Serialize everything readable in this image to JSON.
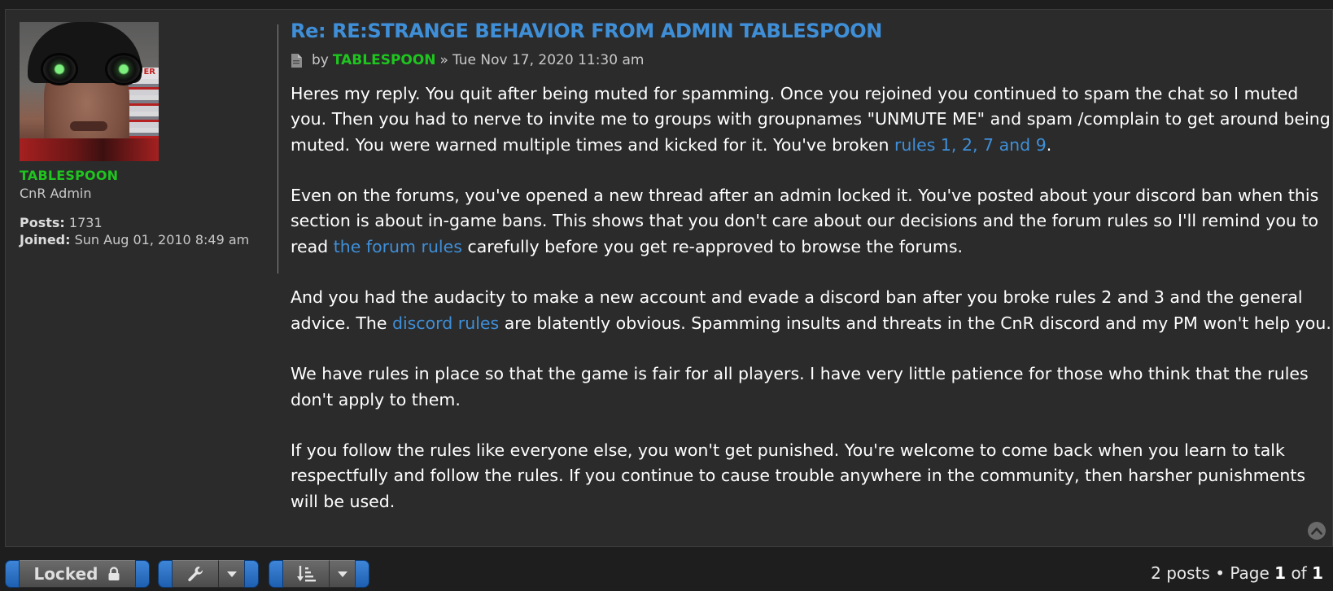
{
  "post": {
    "title": "Re: RE:STRANGE BEHAVIOR FROM ADMIN TABLESPOON",
    "by_label": "by",
    "author": "TABLESPOON",
    "raquo": "»",
    "date": "Tue Nov 17, 2020 11:30 am",
    "paragraphs": [
      {
        "lines": [
          "Heres my reply. You quit after being muted for spamming. Once you rejoined you continued to spam the chat so I muted",
          "you. Then you had to nerve to invite me to groups with groupnames \"UNMUTE ME\" and spam /complain to get around being"
        ],
        "last_before": "muted. You were warned multiple times and kicked for it. You've broken ",
        "link": "rules 1, 2, 7 and 9",
        "last_after": "."
      },
      {
        "lines": [
          "Even on the forums, you've opened a new thread after an admin locked it. You've posted about your discord ban when this",
          "section is about in-game bans. This shows that you don't care about our decisions and the forum rules so I'll remind you to"
        ],
        "last_before": "read ",
        "link": "the forum rules",
        "last_after": " carefully before you get re-approved to browse the forums."
      },
      {
        "lines": [
          "And you had the audacity to make a new account and evade a discord ban after you broke rules 2 and 3 and the general"
        ],
        "last_before": "advice. The ",
        "link": "discord rules",
        "last_after": " are blatently obvious. Spamming insults and threats in the CnR discord and my PM won't help you."
      },
      {
        "lines": [
          "We have rules in place so that the game is fair for all players. I have very little patience for those who think that the rules",
          "don't apply to them."
        ]
      },
      {
        "lines": [
          "If you follow the rules like everyone else, you won't get punished. You're welcome to come back when you learn to talk",
          "respectfully and follow the rules. If you continue to cause trouble anywhere in the community, then harsher punishments",
          "will be used."
        ]
      }
    ]
  },
  "profile": {
    "username": "TABLESPOON",
    "rank": "CnR Admin",
    "posts_label": "Posts:",
    "posts": "1731",
    "joined_label": "Joined:",
    "joined": "Sun Aug 01, 2010 8:49 am",
    "avatar_sign": "ER"
  },
  "toolbar": {
    "locked_label": "Locked",
    "lock_icon": "lock-icon",
    "tools_icon": "wrench-icon",
    "sort_icon": "sort-icon",
    "dropdown_icon": "caret-down-icon"
  },
  "pagination": {
    "posts_text": "2 posts",
    "bullet": "•",
    "page_label": "Page",
    "current": "1",
    "of_label": "of",
    "total": "1"
  },
  "colors": {
    "link": "#3f8fd8",
    "username": "#1fc51f",
    "button_cap": "#2f74c9",
    "background": "#2b2b2b"
  }
}
